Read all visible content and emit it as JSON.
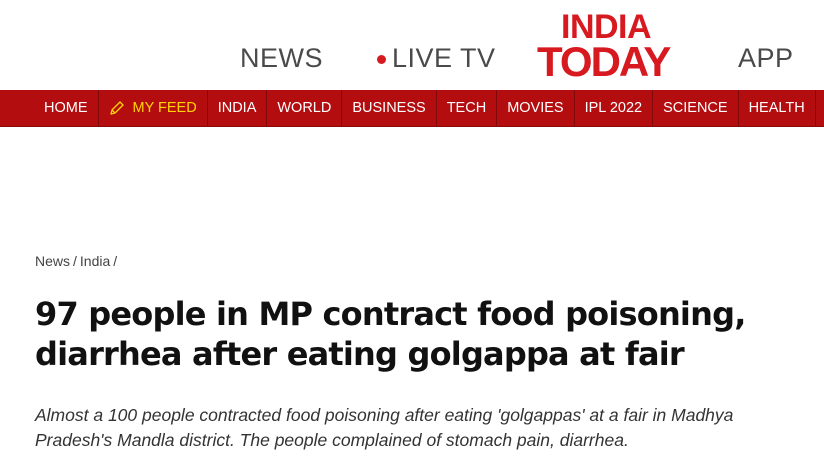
{
  "header": {
    "links": {
      "news": "NEWS",
      "live_tv": "LIVE TV",
      "app": "APP"
    },
    "logo": {
      "line1": "INDIA",
      "line2": "TODAY"
    }
  },
  "nav": {
    "items": [
      {
        "label": "HOME",
        "icon": null
      },
      {
        "label": "MY FEED",
        "icon": "pencil-icon"
      },
      {
        "label": "INDIA",
        "icon": null
      },
      {
        "label": "WORLD",
        "icon": null
      },
      {
        "label": "BUSINESS",
        "icon": null
      },
      {
        "label": "TECH",
        "icon": null
      },
      {
        "label": "MOVIES",
        "icon": null
      },
      {
        "label": "IPL 2022",
        "icon": null
      },
      {
        "label": "SCIENCE",
        "icon": null
      },
      {
        "label": "HEALTH",
        "icon": null
      }
    ],
    "active_index": 1
  },
  "breadcrumb": {
    "items": [
      "News",
      "India"
    ],
    "separator": "/"
  },
  "article": {
    "headline": "97 people in MP contract food poisoning, diarrhea after eating golgappa at fair",
    "summary": "Almost a 100 people contracted food poisoning after eating 'golgappas' at a fair in Madhya Pradesh's Mandla district. The people complained of stomach pain, diarrhea."
  },
  "colors": {
    "brand_red": "#d71920",
    "nav_bg": "#b30d10",
    "active_nav": "#ffd400",
    "live_dot": "#d71920"
  }
}
